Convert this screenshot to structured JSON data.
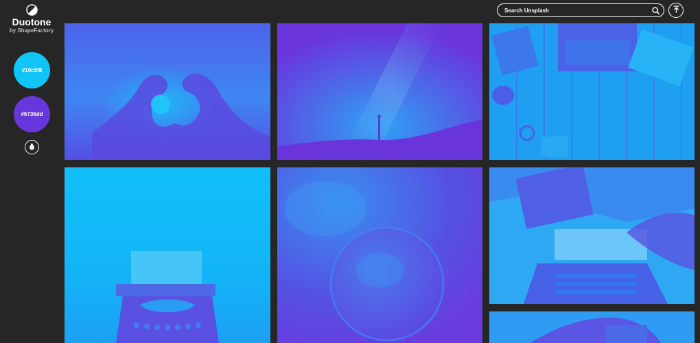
{
  "app": {
    "title": "Duotone",
    "subtitle": "by ShapeFactory"
  },
  "colors": {
    "primary": "#10c5f8",
    "secondary": "#6736dd",
    "background": "#262626"
  },
  "swatches": [
    {
      "label": "#10c5f8",
      "color": "#10c5f8"
    },
    {
      "label": "#6736dd",
      "color": "#6736dd"
    }
  ],
  "search": {
    "placeholder": "Search Unsplash",
    "value": ""
  },
  "icons": {
    "logo": "half-circle-logo-icon",
    "drop": "water-drop-icon",
    "search": "search-icon",
    "upload": "arrow-up-icon"
  },
  "photos": [
    {
      "subject": "heart-hands"
    },
    {
      "subject": "night-sky"
    },
    {
      "subject": "typewriter-desk"
    },
    {
      "subject": "typewriter"
    },
    {
      "subject": "nebula-planet"
    },
    {
      "subject": "laptop-writing"
    },
    {
      "subject": "hands"
    }
  ]
}
